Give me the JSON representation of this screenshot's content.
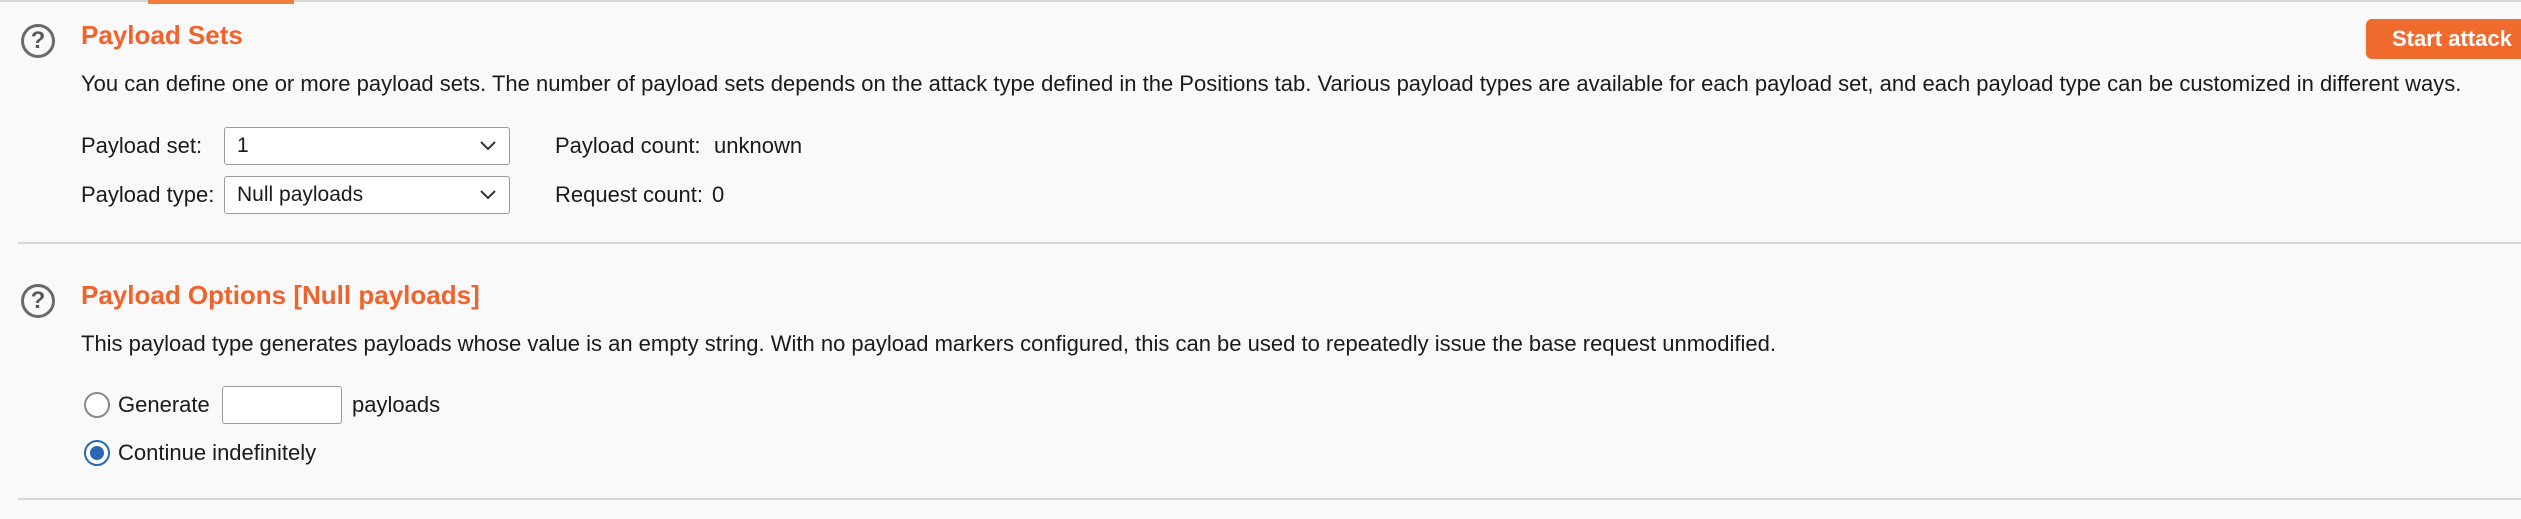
{
  "payload_sets": {
    "title": "Payload Sets",
    "description": "You can define one or more payload sets. The number of payload sets depends on the attack type defined in the Positions tab. Various payload types are available for each payload set, and each payload type can be customized in different ways.",
    "payload_set_label": "Payload set:",
    "payload_set_value": "1",
    "payload_type_label": "Payload type:",
    "payload_type_value": "Null payloads",
    "payload_count_label": "Payload count:",
    "payload_count_value": "unknown",
    "request_count_label": "Request count:",
    "request_count_value": "0",
    "start_attack_label": "Start attack"
  },
  "payload_options": {
    "title": "Payload Options [Null payloads]",
    "description": "This payload type generates payloads whose value is an empty string. With no payload markers configured, this can be used to repeatedly issue the base request unmodified.",
    "generate_label": "Generate",
    "generate_count_value": "",
    "payloads_suffix": "payloads",
    "continue_label": "Continue indefinitely",
    "selected_option": "Continue indefinitely"
  },
  "icons": {
    "help": "help-circle-icon",
    "dropdown": "chevron-down-icon"
  },
  "colors": {
    "accent": "#f1632d",
    "button": "#f26b2e",
    "radio_selected": "#2a68b5"
  }
}
